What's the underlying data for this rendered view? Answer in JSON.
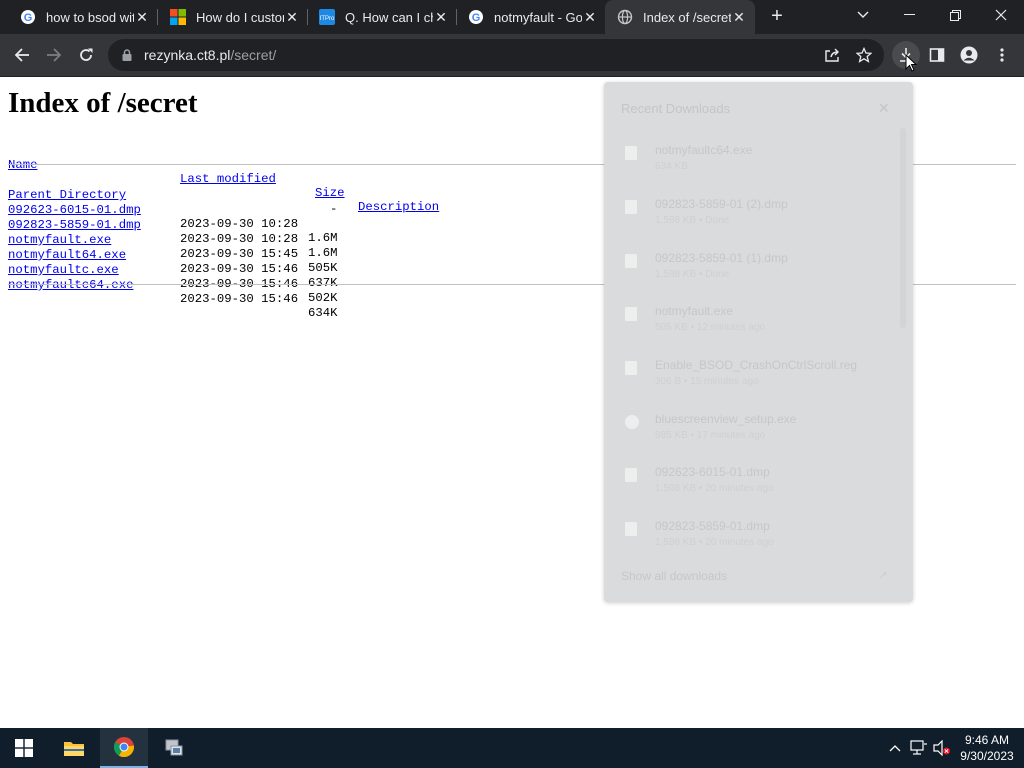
{
  "browser": {
    "tabs": [
      {
        "title": "how to bsod wit",
        "favicon": "google-icon"
      },
      {
        "title": "How do I custor",
        "favicon": "microsoft-icon"
      },
      {
        "title": "Q. How can I ch",
        "favicon": "itpro-icon"
      },
      {
        "title": "notmyfault - Go",
        "favicon": "google-icon"
      },
      {
        "title": "Index of /secret",
        "favicon": "globe-icon",
        "active": true
      }
    ],
    "url_host": "rezynka.ct8.pl",
    "url_path": "/secret/"
  },
  "page": {
    "heading": "Index of /secret",
    "columns": {
      "name": "Name",
      "last_modified": "Last modified",
      "size": "Size",
      "description": "Description"
    },
    "parent": {
      "name": "Parent Directory",
      "size": "-"
    },
    "files": [
      {
        "name": "092623-6015-01.dmp",
        "modified": "2023-09-30 10:28",
        "size": "1.6M"
      },
      {
        "name": "092823-5859-01.dmp",
        "modified": "2023-09-30 10:28",
        "size": "1.6M"
      },
      {
        "name": "notmyfault.exe",
        "modified": "2023-09-30 15:45",
        "size": "505K"
      },
      {
        "name": "notmyfault64.exe",
        "modified": "2023-09-30 15:46",
        "size": "637K"
      },
      {
        "name": "notmyfaultc.exe",
        "modified": "2023-09-30 15:46",
        "size": "502K"
      },
      {
        "name": "notmyfaultc64.exe",
        "modified": "2023-09-30 15:46",
        "size": "634K"
      }
    ]
  },
  "downloads": {
    "title": "Recent Downloads",
    "items": [
      {
        "name": "notmyfaultc64.exe",
        "meta": "634 KB"
      },
      {
        "name": "092823-5859-01 (2).dmp",
        "meta": "1,598 KB • Done"
      },
      {
        "name": "092823-5859-01 (1).dmp",
        "meta": "1,598 KB • Done"
      },
      {
        "name": "notmyfault.exe",
        "meta": "505 KB • 12 minutes ago"
      },
      {
        "name": "Enable_BSOD_CrashOnCtrlScroll.reg",
        "meta": "306 B • 15 minutes ago"
      },
      {
        "name": "bluescreenview_setup.exe",
        "meta": "985 KB • 17 minutes ago"
      },
      {
        "name": "092623-6015-01.dmp",
        "meta": "1,598 KB • 20 minutes ago"
      },
      {
        "name": "092823-5859-01.dmp",
        "meta": "1,598 KB • 20 minutes ago"
      }
    ],
    "show_all": "Show all downloads"
  },
  "taskbar": {
    "time": "9:46 AM",
    "date": "9/30/2023"
  },
  "colors": {
    "link": "#0000ee",
    "chrome_dark": "#202124",
    "chrome_toolbar": "#35363a",
    "taskbar": "#101d2b"
  }
}
